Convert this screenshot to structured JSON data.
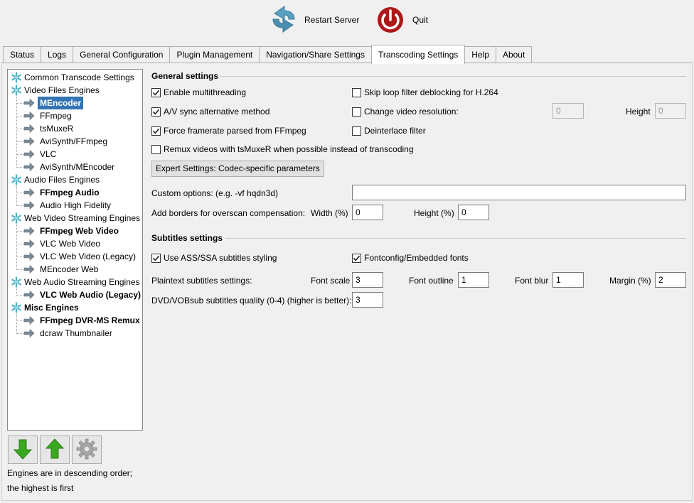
{
  "toolbar": {
    "restart_label": "Restart Server",
    "quit_label": "Quit",
    "icons": {
      "restart": "refresh-arrows-icon",
      "quit": "power-icon"
    },
    "colors": {
      "restart": "#5aa0c0",
      "quit": "#b01818"
    }
  },
  "tabs": [
    {
      "label": "Status"
    },
    {
      "label": "Logs"
    },
    {
      "label": "General Configuration"
    },
    {
      "label": "Plugin Management"
    },
    {
      "label": "Navigation/Share Settings"
    },
    {
      "label": "Transcoding Settings",
      "active": true
    },
    {
      "label": "Help"
    },
    {
      "label": "About"
    }
  ],
  "tree": {
    "items": [
      {
        "label": "Common Transcode Settings",
        "level": 0,
        "icon": "snowflake-icon"
      },
      {
        "label": "Video Files Engines",
        "level": 0,
        "icon": "snowflake-icon"
      },
      {
        "label": "MEncoder",
        "level": 1,
        "icon": "arrow-right-icon",
        "selected": true
      },
      {
        "label": "FFmpeg",
        "level": 1,
        "icon": "arrow-right-icon"
      },
      {
        "label": "tsMuxeR",
        "level": 1,
        "icon": "arrow-right-icon"
      },
      {
        "label": "AviSynth/FFmpeg",
        "level": 1,
        "icon": "arrow-right-icon"
      },
      {
        "label": "VLC",
        "level": 1,
        "icon": "arrow-right-icon"
      },
      {
        "label": "AviSynth/MEncoder",
        "level": 1,
        "icon": "arrow-right-icon"
      },
      {
        "label": "Audio Files Engines",
        "level": 0,
        "icon": "snowflake-icon"
      },
      {
        "label": "FFmpeg Audio",
        "level": 1,
        "icon": "arrow-right-icon",
        "bold": true
      },
      {
        "label": "Audio High Fidelity",
        "level": 1,
        "icon": "arrow-right-icon"
      },
      {
        "label": "Web Video Streaming Engines",
        "level": 0,
        "icon": "snowflake-icon"
      },
      {
        "label": "FFmpeg Web Video",
        "level": 1,
        "icon": "arrow-right-icon",
        "bold": true
      },
      {
        "label": "VLC Web Video",
        "level": 1,
        "icon": "arrow-right-icon"
      },
      {
        "label": "VLC Web Video (Legacy)",
        "level": 1,
        "icon": "arrow-right-icon"
      },
      {
        "label": "MEncoder Web",
        "level": 1,
        "icon": "arrow-right-icon"
      },
      {
        "label": "Web Audio Streaming Engines",
        "level": 0,
        "icon": "snowflake-icon"
      },
      {
        "label": "VLC Web Audio (Legacy)",
        "level": 1,
        "icon": "arrow-right-icon",
        "bold": true
      },
      {
        "label": "Misc Engines",
        "level": 0,
        "icon": "snowflake-icon",
        "bold": true
      },
      {
        "label": "FFmpeg DVR-MS Remux",
        "level": 1,
        "icon": "arrow-right-icon",
        "bold": true
      },
      {
        "label": "dcraw Thumbnailer",
        "level": 1,
        "icon": "arrow-right-icon"
      }
    ]
  },
  "engine_buttons": {
    "icons": [
      "arrow-down-icon",
      "arrow-up-icon",
      "gear-icon"
    ],
    "colors": {
      "arrows": "#3aa820"
    }
  },
  "note": "Engines are in descending order; the highest is first",
  "general": {
    "title": "General settings",
    "enable_multithreading": {
      "label": "Enable multithreading",
      "checked": true
    },
    "skip_loop_filter": {
      "label": "Skip loop filter deblocking for H.264",
      "checked": false
    },
    "av_sync": {
      "label": "A/V sync alternative method",
      "checked": true
    },
    "change_resolution": {
      "label": "Change video resolution:",
      "checked": false
    },
    "res_width_value": "0",
    "height_label": "Height",
    "res_height_value": "0",
    "force_framerate": {
      "label": "Force framerate parsed from FFmpeg",
      "checked": true
    },
    "deinterlace": {
      "label": "Deinterlace filter",
      "checked": false
    },
    "remux_tsmuxer": {
      "label": "Remux videos with tsMuxeR when possible instead of transcoding",
      "checked": false
    },
    "expert_button": "Expert Settings: Codec-specific parameters",
    "custom_options_label": "Custom options: (e.g. -vf hqdn3d)",
    "custom_options_value": "",
    "borders_label": "Add borders for overscan compensation:",
    "width_pct_label": "Width (%)",
    "width_pct_value": "0",
    "height_pct_label": "Height (%)",
    "height_pct_value": "0"
  },
  "subtitles": {
    "title": "Subtitles settings",
    "ass_ssa": {
      "label": "Use ASS/SSA subtitles styling",
      "checked": true
    },
    "fontconfig": {
      "label": "Fontconfig/Embedded fonts",
      "checked": true
    },
    "plaintext_label": "Plaintext subtitles settings:",
    "font_scale_label": "Font scale",
    "font_scale_value": "3",
    "font_outline_label": "Font outline",
    "font_outline_value": "1",
    "font_blur_label": "Font blur",
    "font_blur_value": "1",
    "margin_label": "Margin (%)",
    "margin_value": "2",
    "dvd_quality_label": "DVD/VOBsub subtitles quality (0-4) (higher is better):",
    "dvd_quality_value": "3"
  }
}
